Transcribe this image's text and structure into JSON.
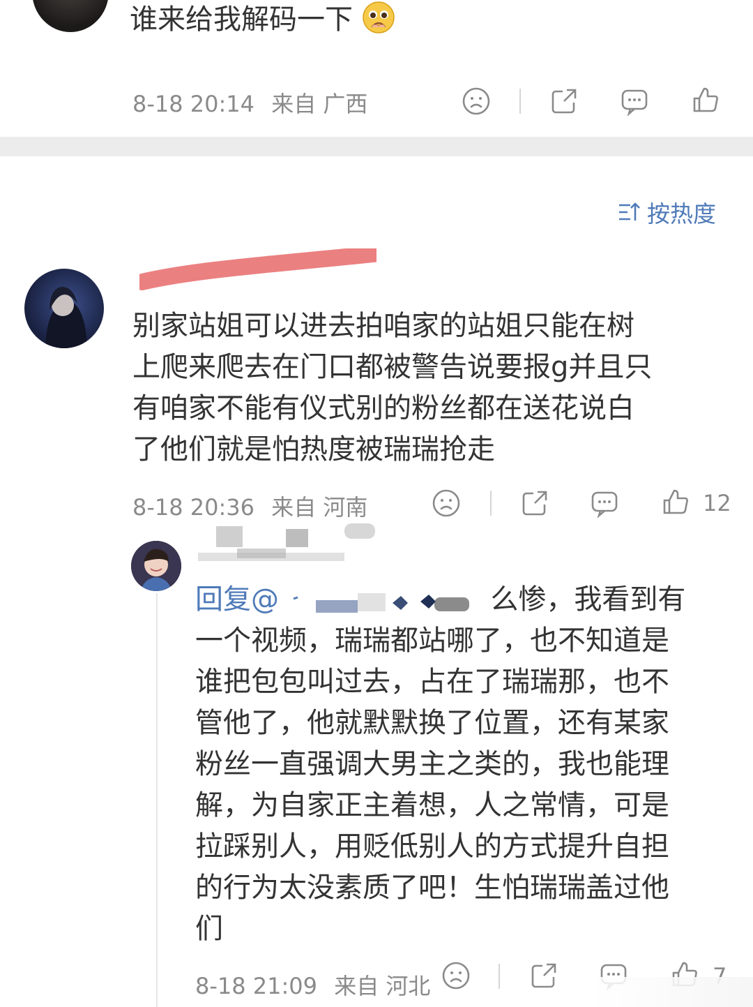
{
  "comment_top": {
    "text": "谁来给我解码一下",
    "emoji": "pleading-face-emoji",
    "time": "8-18 20:14",
    "location": "来自 广西"
  },
  "sort": {
    "label": "按热度",
    "icon": "sort-icon"
  },
  "comment_main": {
    "text_lines": [
      "别家站姐可以进去拍咱家的站姐只能在树",
      "上爬来爬去在门口都被警告说要报g并且只",
      "有咱家不能有仪式别的粉丝都在送花说白",
      "了他们就是怕热度被瑞瑞抢走"
    ],
    "time": "8-18 20:36",
    "location": "来自 河南",
    "likes": "12"
  },
  "reply": {
    "prefix": "回复@",
    "text_first_tail": "么惨，我看到有",
    "text_lines": [
      "一个视频，瑞瑞都站哪了，也不知道是",
      "谁把包包叫过去，占在了瑞瑞那，也不",
      "管他了，他就默默换了位置，还有某家",
      "粉丝一直强调大男主之类的，我也能理",
      "解，为自家正主着想，人之常情，可是",
      "拉踩别人，用贬低别人的方式提升自担",
      "的行为太没素质了吧！生怕瑞瑞盖过他",
      "们"
    ],
    "time": "8-18 21:09",
    "location": "来自 河北",
    "likes": "7"
  },
  "colors": {
    "accent": "#4f7ab8",
    "muted": "#8a8a8a",
    "divider": "#ececec",
    "redaction": "#e86a6a"
  }
}
